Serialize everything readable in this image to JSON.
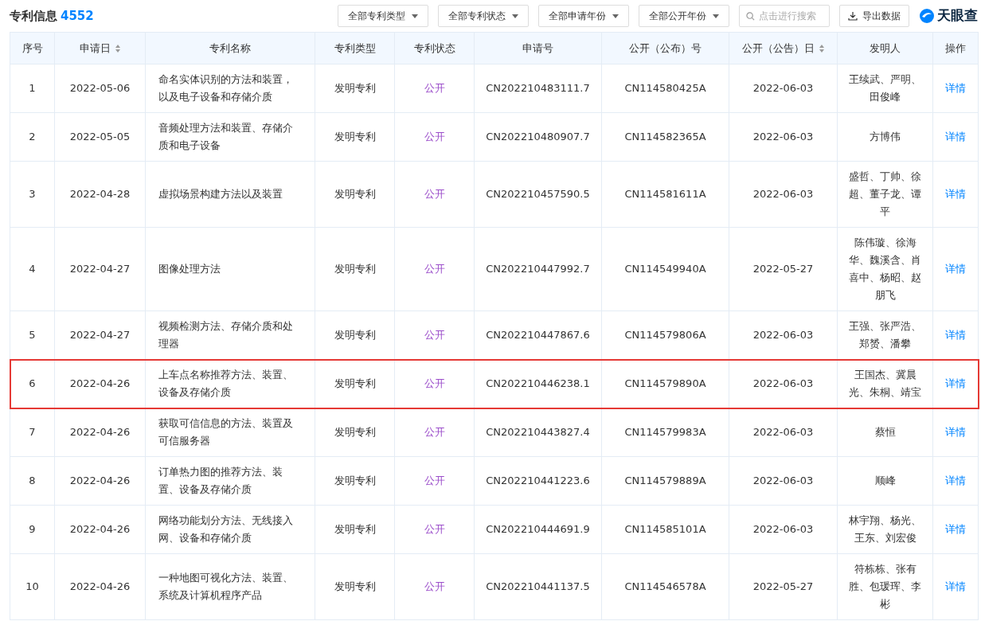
{
  "header": {
    "title": "专利信息",
    "count": "4552",
    "filters": [
      "全部专利类型",
      "全部专利状态",
      "全部申请年份",
      "全部公开年份"
    ],
    "search": {
      "placeholder": "点击进行搜索"
    },
    "export_button": "导出数据",
    "logo": "天眼查"
  },
  "table": {
    "columns": [
      {
        "label": "序号",
        "sortable": false
      },
      {
        "label": "申请日",
        "sortable": true
      },
      {
        "label": "专利名称",
        "sortable": false
      },
      {
        "label": "专利类型",
        "sortable": false
      },
      {
        "label": "专利状态",
        "sortable": false
      },
      {
        "label": "申请号",
        "sortable": false
      },
      {
        "label": "公开（公布）号",
        "sortable": false
      },
      {
        "label": "公开（公告）日",
        "sortable": true
      },
      {
        "label": "发明人",
        "sortable": false
      },
      {
        "label": "操作",
        "sortable": false
      }
    ],
    "rows": [
      {
        "no": "1",
        "date": "2022-05-06",
        "name": "命名实体识别的方法和装置，以及电子设备和存储介质",
        "type": "发明专利",
        "status": "公开",
        "app_no": "CN202210483111.7",
        "pub_no": "CN114580425A",
        "pub_date": "2022-06-03",
        "inventors": "王续武、严明、田俊峰",
        "action": "详情",
        "highlighted": false
      },
      {
        "no": "2",
        "date": "2022-05-05",
        "name": "音频处理方法和装置、存储介质和电子设备",
        "type": "发明专利",
        "status": "公开",
        "app_no": "CN202210480907.7",
        "pub_no": "CN114582365A",
        "pub_date": "2022-06-03",
        "inventors": "方博伟",
        "action": "详情",
        "highlighted": false
      },
      {
        "no": "3",
        "date": "2022-04-28",
        "name": "虚拟场景构建方法以及装置",
        "type": "发明专利",
        "status": "公开",
        "app_no": "CN202210457590.5",
        "pub_no": "CN114581611A",
        "pub_date": "2022-06-03",
        "inventors": "盛哲、丁帅、徐超、董子龙、谭平",
        "action": "详情",
        "highlighted": false
      },
      {
        "no": "4",
        "date": "2022-04-27",
        "name": "图像处理方法",
        "type": "发明专利",
        "status": "公开",
        "app_no": "CN202210447992.7",
        "pub_no": "CN114549940A",
        "pub_date": "2022-05-27",
        "inventors": "陈伟璇、徐海华、魏溪含、肖喜中、杨昭、赵朋飞",
        "action": "详情",
        "highlighted": false
      },
      {
        "no": "5",
        "date": "2022-04-27",
        "name": "视频检测方法、存储介质和处理器",
        "type": "发明专利",
        "status": "公开",
        "app_no": "CN202210447867.6",
        "pub_no": "CN114579806A",
        "pub_date": "2022-06-03",
        "inventors": "王强、张严浩、郑赟、潘攀",
        "action": "详情",
        "highlighted": false
      },
      {
        "no": "6",
        "date": "2022-04-26",
        "name": "上车点名称推荐方法、装置、设备及存储介质",
        "type": "发明专利",
        "status": "公开",
        "app_no": "CN202210446238.1",
        "pub_no": "CN114579890A",
        "pub_date": "2022-06-03",
        "inventors": "王国杰、冀晨光、朱桐、靖宝",
        "action": "详情",
        "highlighted": true
      },
      {
        "no": "7",
        "date": "2022-04-26",
        "name": "获取可信信息的方法、装置及可信服务器",
        "type": "发明专利",
        "status": "公开",
        "app_no": "CN202210443827.4",
        "pub_no": "CN114579983A",
        "pub_date": "2022-06-03",
        "inventors": "蔡恒",
        "action": "详情",
        "highlighted": false
      },
      {
        "no": "8",
        "date": "2022-04-26",
        "name": "订单热力图的推荐方法、装置、设备及存储介质",
        "type": "发明专利",
        "status": "公开",
        "app_no": "CN202210441223.6",
        "pub_no": "CN114579889A",
        "pub_date": "2022-06-03",
        "inventors": "顺峰",
        "action": "详情",
        "highlighted": false
      },
      {
        "no": "9",
        "date": "2022-04-26",
        "name": "网络功能划分方法、无线接入网、设备和存储介质",
        "type": "发明专利",
        "status": "公开",
        "app_no": "CN202210444691.9",
        "pub_no": "CN114585101A",
        "pub_date": "2022-06-03",
        "inventors": "林宇翔、杨光、王东、刘宏俊",
        "action": "详情",
        "highlighted": false
      },
      {
        "no": "10",
        "date": "2022-04-26",
        "name": "一种地图可视化方法、装置、系统及计算机程序产品",
        "type": "发明专利",
        "status": "公开",
        "app_no": "CN202210441137.5",
        "pub_no": "CN114546578A",
        "pub_date": "2022-05-27",
        "inventors": "符栋栋、张有胜、包瑗珲、李彬",
        "action": "详情",
        "highlighted": false
      }
    ]
  }
}
